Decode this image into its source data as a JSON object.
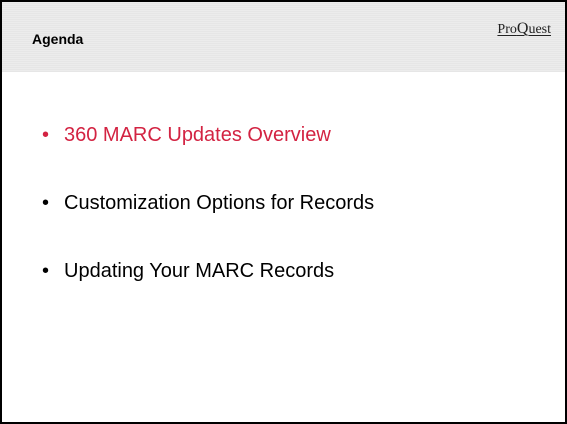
{
  "slide": {
    "title": "Agenda",
    "logo": {
      "prefix": "Pro",
      "q": "Q",
      "suffix": "uest"
    },
    "bullet_glyph": "•",
    "accent_color": "#d32342",
    "items": [
      {
        "label": "360 MARC Updates Overview",
        "active": true
      },
      {
        "label": "Customization Options for Records",
        "active": false
      },
      {
        "label": "Updating Your MARC Records",
        "active": false
      }
    ]
  }
}
